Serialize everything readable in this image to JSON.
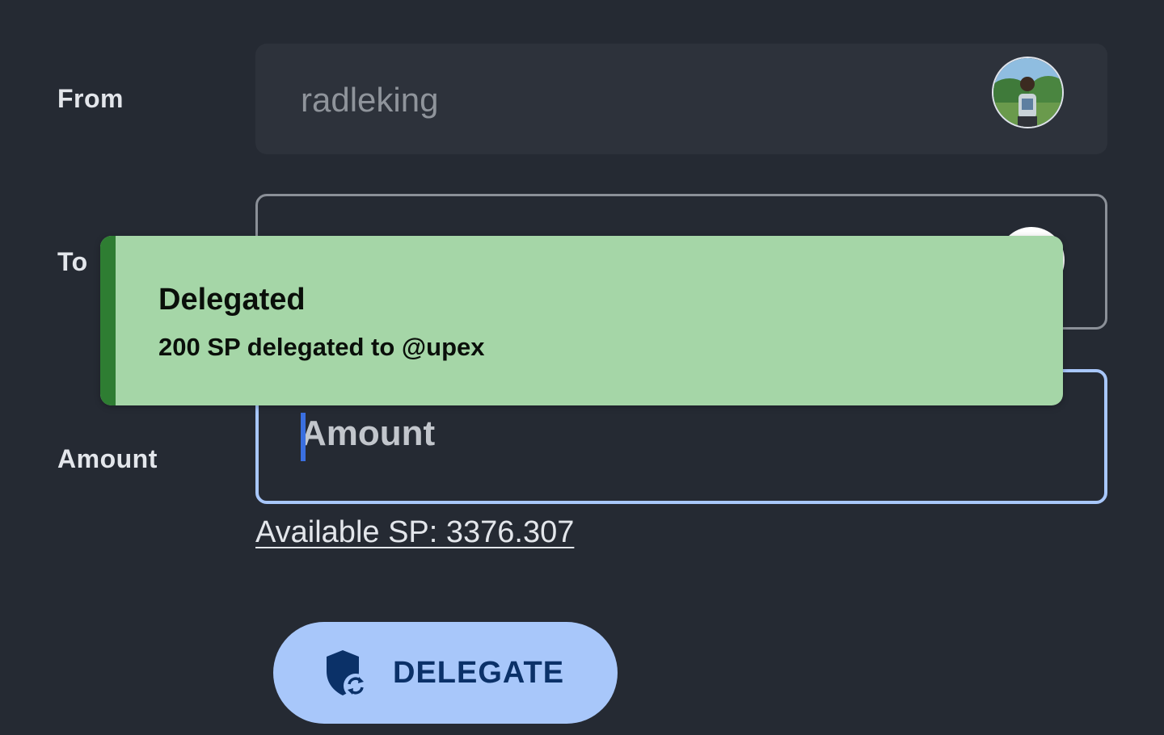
{
  "form": {
    "from_label": "From",
    "from_value": "radleking",
    "to_label": "To",
    "amount_label": "Amount",
    "amount_placeholder": "Amount",
    "amount_value": ""
  },
  "available_sp": "Available SP: 3376.307",
  "delegate_button": {
    "label": "DELEGATE",
    "icon": "shield-sync-icon"
  },
  "toast": {
    "title": "Delegated",
    "message": "200 SP delegated to @upex",
    "accent_color": "#2e7d32",
    "background_color": "#a5d6a7"
  },
  "colors": {
    "background": "#252a33",
    "field_background": "#2d323b",
    "focus_border": "#a8c7fa",
    "button_background": "#a8c7fa",
    "button_text": "#0b3168"
  }
}
